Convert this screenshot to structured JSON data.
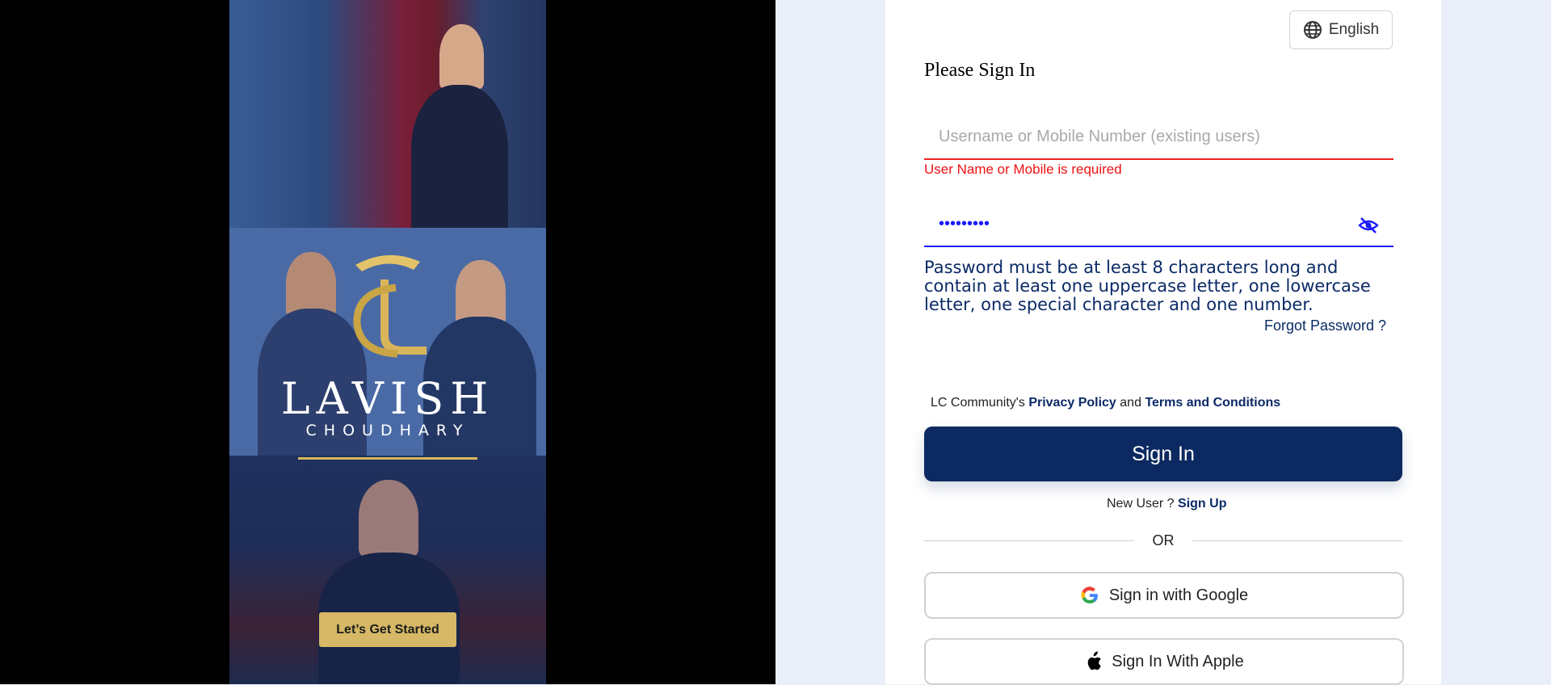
{
  "language": {
    "label": "English"
  },
  "page": {
    "title": "Please Sign In"
  },
  "poster": {
    "brand_title": "LAVISH",
    "brand_subtitle": "CHOUDHARY",
    "cta": "Let’s Get Started"
  },
  "form": {
    "username_placeholder": "Username or Mobile Number (existing users)",
    "username_value": "",
    "username_error": "User Name or Mobile is required",
    "password_value": "•••••••••",
    "password_hint": "Password must be at least 8 characters long and contain at least one uppercase letter, one lowercase letter, one special character and one number.",
    "forgot_password": "Forgot Password ?",
    "policy_prefix": "LC Community's",
    "privacy_policy": "Privacy Policy",
    "and": "and",
    "terms": "Terms and Conditions",
    "signin_label": "Sign In",
    "new_user": "New User ?",
    "signup_label": "Sign Up",
    "or": "OR",
    "google_label": "Sign in with Google",
    "apple_label": "Sign In With Apple"
  },
  "colors": {
    "primary": "#0c2a61",
    "error": "#e11111",
    "accent_gold": "#d6b866",
    "focus_blue": "#1a1aff"
  },
  "icons": [
    "globe-icon",
    "eye-off-icon",
    "google-icon",
    "apple-icon",
    "lion-crest-icon"
  ]
}
